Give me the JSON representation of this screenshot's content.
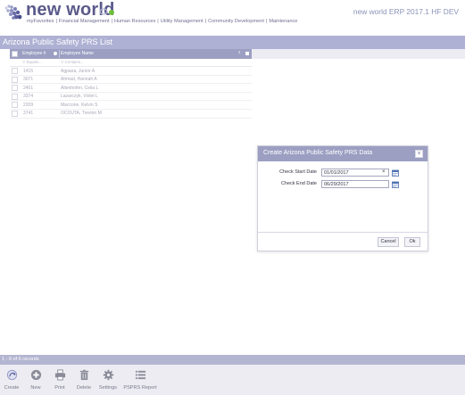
{
  "app": {
    "logo_text": "new world",
    "version": "new world ERP 2017.1 HF DEV",
    "top_nav": [
      {
        "label": "myFavorites"
      },
      {
        "label": "Financial Management"
      },
      {
        "label": "Human Resources"
      },
      {
        "label": "Utility Management"
      },
      {
        "label": "Community Development"
      },
      {
        "label": "Maintenance"
      }
    ]
  },
  "page": {
    "title": "Arizona Public Safety PRS List"
  },
  "grid": {
    "columns": [
      "Employee #",
      "Employee Name"
    ],
    "filters": [
      "Equals...",
      "Contains..."
    ],
    "rows": [
      {
        "number": "1415",
        "name": "Agpaoa, Junior A"
      },
      {
        "number": "3071",
        "name": "Ahmad, Hannah A"
      },
      {
        "number": "2401",
        "name": "Altenhofen, Celia L"
      },
      {
        "number": "3374",
        "name": "Lazarczyk, Violet L"
      },
      {
        "number": "2209",
        "name": "Maccone, Kelvin S"
      },
      {
        "number": "3741",
        "name": "OCOUTA, Trevion M"
      }
    ]
  },
  "dialog": {
    "title": "Create Arizona Public Safety PRS Data",
    "fields": [
      {
        "label": "Check Start Date",
        "value": "01/01/2017"
      },
      {
        "label": "Check End Date",
        "value": "06/29/2017"
      }
    ],
    "clear_glyph": "×",
    "cancel_label": "Cancel",
    "ok_label": "Ok"
  },
  "status": {
    "record_count": "1 - 6 of 6 records"
  },
  "toolbar": [
    {
      "label": "Create",
      "icon": "create-icon"
    },
    {
      "label": "New",
      "icon": "plus-circle-icon"
    },
    {
      "label": "Print",
      "icon": "printer-icon"
    },
    {
      "label": "Delete",
      "icon": "trash-icon"
    },
    {
      "label": "Settings",
      "icon": "gear-icon"
    },
    {
      "label": "PSPRS Report",
      "icon": "report-list-icon"
    }
  ],
  "colors": {
    "brand": "#5a5a8a",
    "header_band": "#aeb1d3",
    "grid_header": "#9c9fc2",
    "toolbar_bg": "#ececf2"
  }
}
